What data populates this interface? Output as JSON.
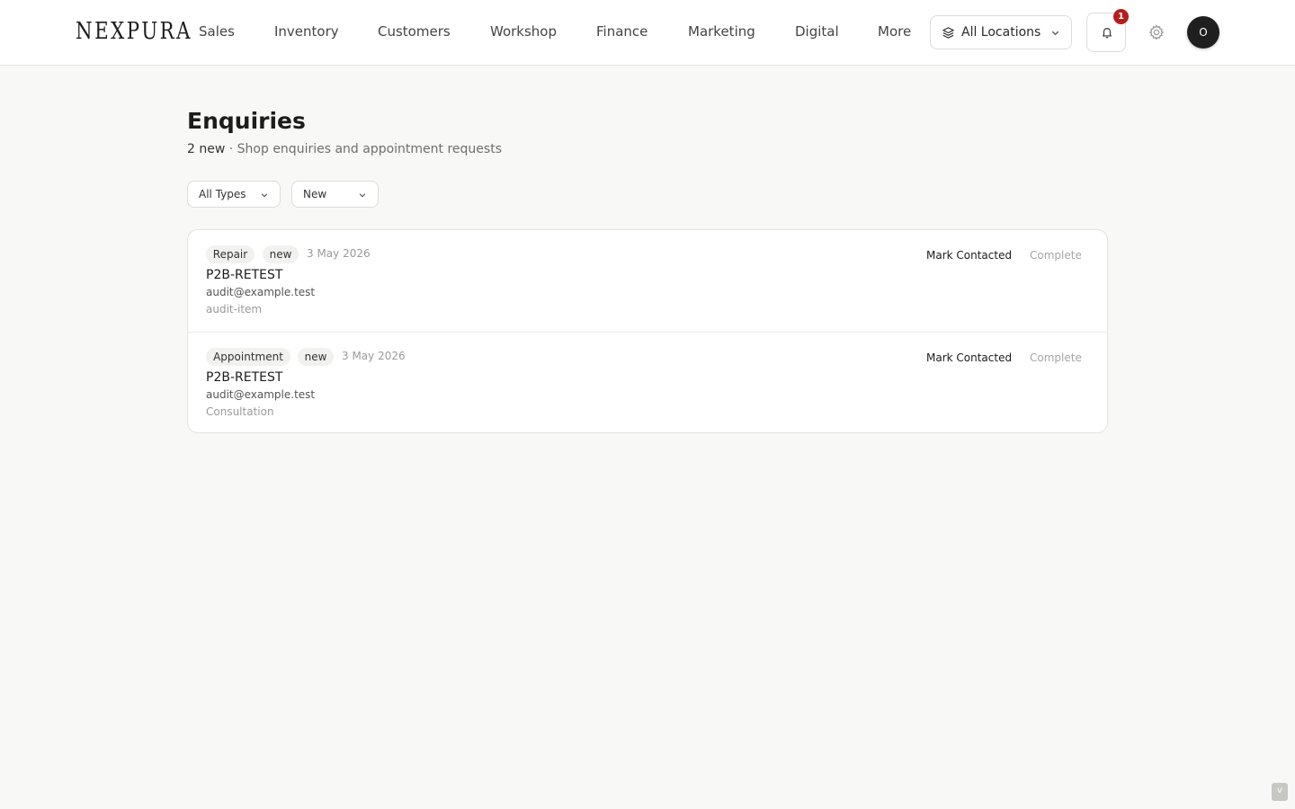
{
  "app": {
    "logo": "NEXPURA"
  },
  "nav": {
    "items": [
      "Sales",
      "Inventory",
      "Customers",
      "Workshop",
      "Finance",
      "Marketing",
      "Digital",
      "More"
    ]
  },
  "header": {
    "location_selector": "All Locations",
    "notification_count": "1",
    "avatar_initial": "O"
  },
  "page": {
    "title": "Enquiries",
    "new_count": "2 new",
    "separator": " · ",
    "description": "Shop enquiries and appointment requests"
  },
  "filters": {
    "type": "All Types",
    "status": "New"
  },
  "enquiries": [
    {
      "type": "Repair",
      "status": "new",
      "date": "3 May 2026",
      "name": "P2B-RETEST",
      "email": "audit@example.test",
      "detail": "audit-item",
      "action_contacted": "Mark Contacted",
      "action_complete": "Complete"
    },
    {
      "type": "Appointment",
      "status": "new",
      "date": "3 May 2026",
      "name": "P2B-RETEST",
      "email": "audit@example.test",
      "detail": "Consultation",
      "action_contacted": "Mark Contacted",
      "action_complete": "Complete"
    }
  ],
  "corner_toggle": "v",
  "colors": {
    "background": "#f8f8f7",
    "badge": "#b51d1d",
    "avatar": "#1f1f1f"
  }
}
